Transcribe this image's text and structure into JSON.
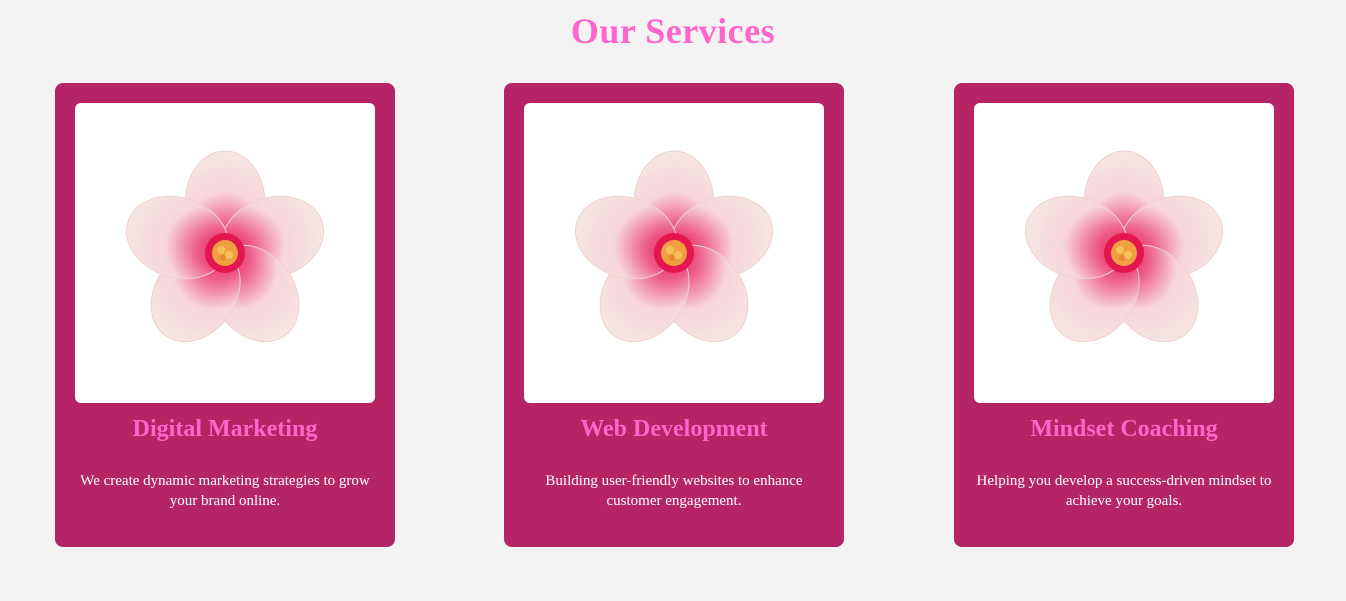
{
  "section": {
    "title": "Our Services"
  },
  "colors": {
    "accent": "#ff66cc",
    "card_bg": "#b52465",
    "page_bg": "#f3f3f3"
  },
  "services": [
    {
      "title": "Digital Marketing",
      "description": "We create dynamic marketing strategies to grow your brand online.",
      "icon": "hibiscus-flower-image"
    },
    {
      "title": "Web Development",
      "description": "Building user-friendly websites to enhance customer engagement.",
      "icon": "hibiscus-flower-image"
    },
    {
      "title": "Mindset Coaching",
      "description": "Helping you develop a success-driven mindset to achieve your goals.",
      "icon": "hibiscus-flower-image"
    }
  ]
}
